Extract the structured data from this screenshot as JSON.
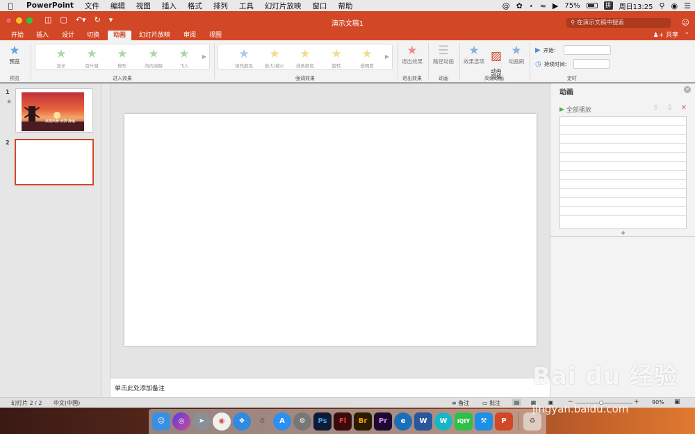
{
  "menubar": {
    "app": "PowerPoint",
    "items": [
      "文件",
      "编辑",
      "视图",
      "插入",
      "格式",
      "排列",
      "工具",
      "幻灯片放映",
      "窗口",
      "帮助"
    ],
    "battery": "75%",
    "input_method": "拼",
    "clock": "周日13:25"
  },
  "window": {
    "title": "演示文稿1",
    "search_placeholder": "在演示文稿中搜索",
    "share": "共享"
  },
  "ribbon_tabs": [
    "开始",
    "插入",
    "设计",
    "切换",
    "动画",
    "幻灯片放映",
    "审阅",
    "视图"
  ],
  "active_tab": "动画",
  "ribbon": {
    "preview": {
      "label": "预览",
      "group": "预览"
    },
    "entrance": {
      "group": "进入效果",
      "items": [
        "显示",
        "百叶窗",
        "楔形",
        "向内溶解",
        "飞入"
      ]
    },
    "emphasis": {
      "group": "强调效果",
      "items": [
        "填充颜色",
        "放大/缩小",
        "线条颜色",
        "旋转",
        "透明度"
      ]
    },
    "exit": {
      "label": "退出效果",
      "group": "退出效果"
    },
    "path": {
      "label": "路径动画",
      "group": "动画"
    },
    "advanced": {
      "group": "高级动画",
      "effect_options": "效果选项",
      "animation_pane": "动画\n窗格",
      "reorder": "动画刷"
    },
    "timing": {
      "group": "定时",
      "start_label": "开始:",
      "duration_label": "持续时间:"
    }
  },
  "slides": [
    {
      "number": "1",
      "thumb_text": "美丽风景 欣赏 静谧"
    },
    {
      "number": "2"
    }
  ],
  "notes_placeholder": "单击此处添加备注",
  "animation_pane": {
    "title": "动画",
    "play_all": "全部播放"
  },
  "status": {
    "slide_info": "幻灯片 2 / 2",
    "language": "中文(中国)",
    "notes": "备注",
    "comments": "批注",
    "zoom": "90%"
  },
  "watermark": {
    "brand": "Bai du 经验",
    "url": "jingyan.baidu.com"
  },
  "dock_apps": [
    "Finder",
    "Siri",
    "Launchpad",
    "Chrome",
    "Safari",
    "QQ",
    "App Store",
    "System Preferences",
    "Photoshop",
    "Flash",
    "Bridge",
    "Premiere",
    "Edge",
    "Word",
    "iQiyi",
    "iQIYI",
    "Xcode",
    "PowerPoint",
    "Trash"
  ]
}
